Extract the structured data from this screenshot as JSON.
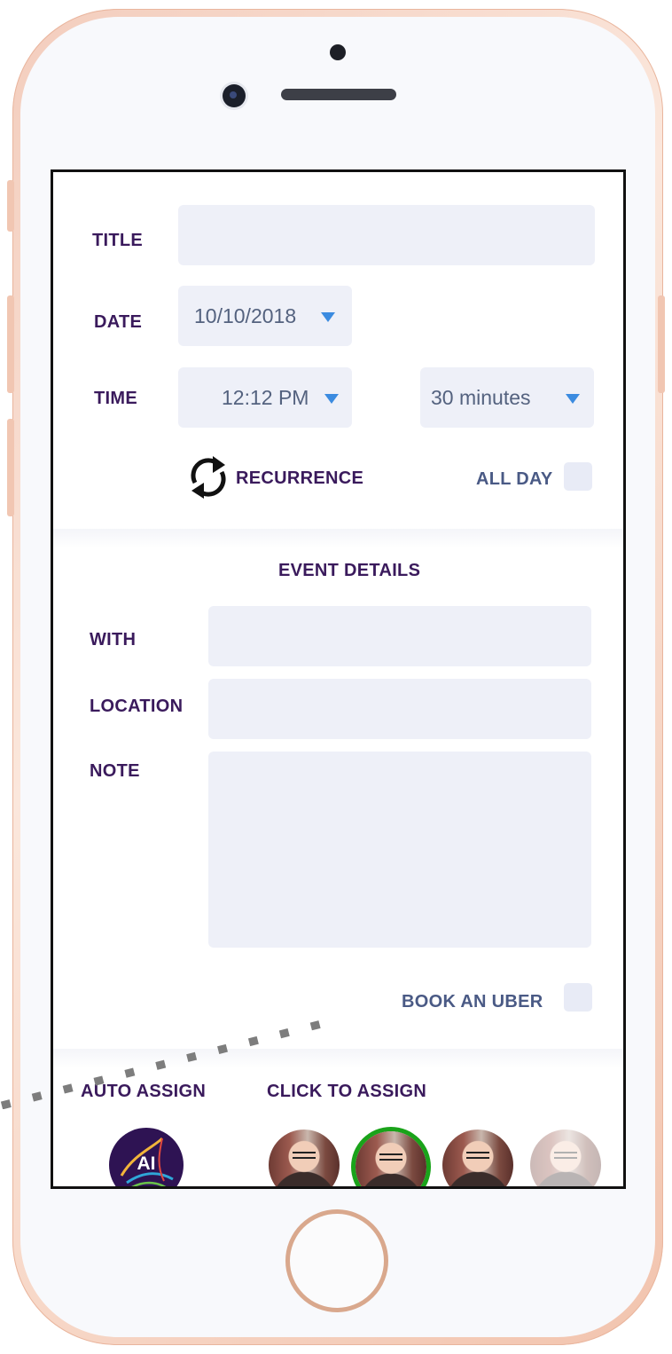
{
  "form": {
    "title_label": "TITLE",
    "title_value": "",
    "date_label": "DATE",
    "date_value": "10/10/2018",
    "time_label": "TIME",
    "time_value": "12:12 PM",
    "duration_value": "30 minutes",
    "recurrence_label": "RECURRENCE",
    "all_day_label": "ALL DAY",
    "all_day_checked": false
  },
  "details": {
    "heading": "EVENT DETAILS",
    "with_label": "WITH",
    "with_value": "",
    "location_label": "LOCATION",
    "location_value": "",
    "note_label": "NOTE",
    "note_value": "",
    "uber_label": "BOOK AN UBER",
    "uber_checked": false
  },
  "assign": {
    "auto_label": "AUTO ASSIGN",
    "click_label": "CLICK TO ASSIGN",
    "ai_badge_text": "AI",
    "assignees": [
      {
        "state": "normal"
      },
      {
        "state": "selected"
      },
      {
        "state": "normal"
      },
      {
        "state": "faded"
      }
    ]
  },
  "colors": {
    "label": "#3a1a5c",
    "field_bg": "#eef0f8",
    "caret": "#3b8be0",
    "selected_ring": "#1aa31a",
    "ai_badge": "#2e1353"
  }
}
